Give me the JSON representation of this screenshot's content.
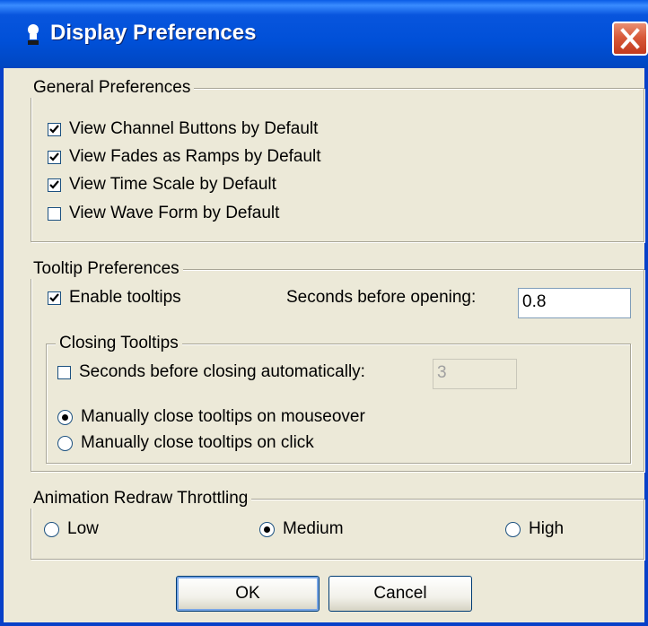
{
  "window": {
    "title": "Display Preferences",
    "title_icon": "app-icon",
    "close_icon": "close-icon",
    "colors": {
      "titlebar": "#0050d8",
      "close": "#d85a3a",
      "face": "#ece9d8"
    }
  },
  "general": {
    "legend": "General Preferences",
    "items": [
      {
        "label": "View Channel Buttons by Default",
        "checked": true
      },
      {
        "label": "View Fades as Ramps by Default",
        "checked": true
      },
      {
        "label": "View Time Scale by Default",
        "checked": true
      },
      {
        "label": "View Wave Form by Default",
        "checked": false
      }
    ]
  },
  "tooltip": {
    "legend": "Tooltip Preferences",
    "enable_label": "Enable tooltips",
    "enable_checked": true,
    "seconds_opening_label": "Seconds before opening:",
    "seconds_opening_value": "0.8",
    "closing": {
      "legend": "Closing Tooltips",
      "auto_close_label": "Seconds before closing automatically:",
      "auto_close_checked": false,
      "auto_close_value": "3",
      "radio_mouseover_label": "Manually close tooltips on mouseover",
      "radio_click_label": "Manually close tooltips on click",
      "selected": "mouseover"
    }
  },
  "animation": {
    "legend": "Animation Redraw Throttling",
    "options": [
      "Low",
      "Medium",
      "High"
    ],
    "selected": "Medium"
  },
  "buttons": {
    "ok": "OK",
    "cancel": "Cancel"
  }
}
